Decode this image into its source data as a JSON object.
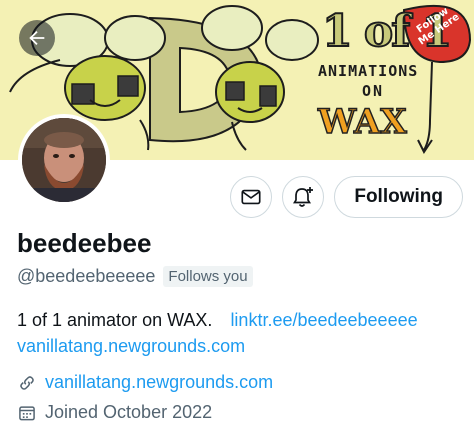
{
  "banner": {
    "title_line_1": "1 of 1",
    "title_line_2": "ANIMATIONS",
    "title_line_3": "ON",
    "title_line_4": "WAX",
    "badge_text": "Follow Me Here",
    "letter": "D"
  },
  "profile": {
    "display_name": "beedeebee",
    "handle": "@beedeebeeeee",
    "follows_you": "Follows you",
    "bio_text": "1 of 1 animator on WAX.",
    "bio_link_1": "linktr.ee/beedeebeeeee",
    "bio_link_2": "vanillatang.newgrounds.com",
    "website": "vanillatang.newgrounds.com",
    "joined": "Joined October 2022"
  },
  "actions": {
    "following_label": "Following"
  },
  "colors": {
    "link": "#1d9bf0",
    "muted": "#536471",
    "text": "#0f1419",
    "banner_bg": "#f4f1b4"
  },
  "icons": [
    "back-arrow-icon",
    "message-icon",
    "notification-bell-icon",
    "link-icon",
    "calendar-icon"
  ]
}
